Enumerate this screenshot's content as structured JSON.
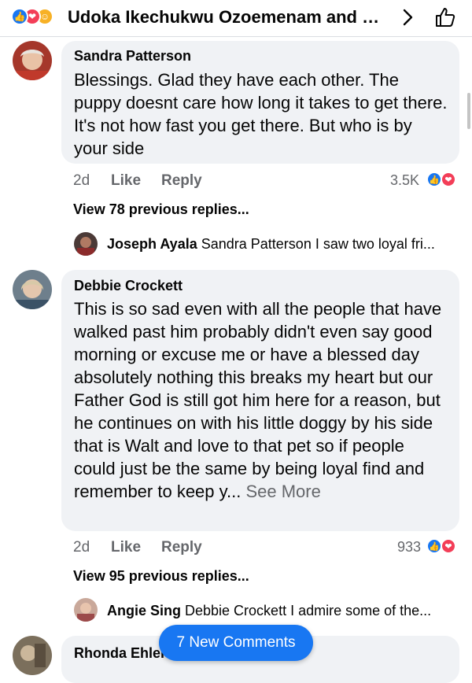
{
  "header": {
    "title": "Udoka Ikechukwu Ozoemenam and 1...",
    "reactions": [
      "like-icon",
      "love-icon",
      "care-icon"
    ]
  },
  "comments": [
    {
      "author": "Sandra Patterson",
      "text": "Blessings. Glad they have each other. The puppy doesnt care how  long it takes to get there. It's not how fast you get there. But who is by your side",
      "time": "2d",
      "like": "Like",
      "reply": "Reply",
      "reaction_count": "3.5K",
      "view_replies": "View 78 previous replies...",
      "preview_reply": {
        "author": "Joseph Ayala",
        "text": "Sandra Patterson I saw two loyal fri..."
      }
    },
    {
      "author": "Debbie Crockett",
      "text": "This is so sad even with all the people that have walked past him probably didn't even say good morning or excuse me or have a blessed day absolutely nothing this breaks my heart but our Father God is still got him here for a reason, but he continues on with his little doggy by his side that is Walt and love to that pet so if people could just be the same by being loyal find and remember to keep y...",
      "see_more": " See More",
      "time": "2d",
      "like": "Like",
      "reply": "Reply",
      "reaction_count": "933",
      "view_replies": "View 95 previous replies...",
      "preview_reply": {
        "author": "Angie Sing",
        "text": "Debbie Crockett I admire  some of the..."
      }
    },
    {
      "author": "Rhonda Ehler"
    }
  ],
  "new_comments_label": "7 New Comments",
  "colors": {
    "accent": "#1877f2",
    "love": "#f33e58",
    "bubble": "#f0f2f5",
    "meta": "#65676b"
  }
}
